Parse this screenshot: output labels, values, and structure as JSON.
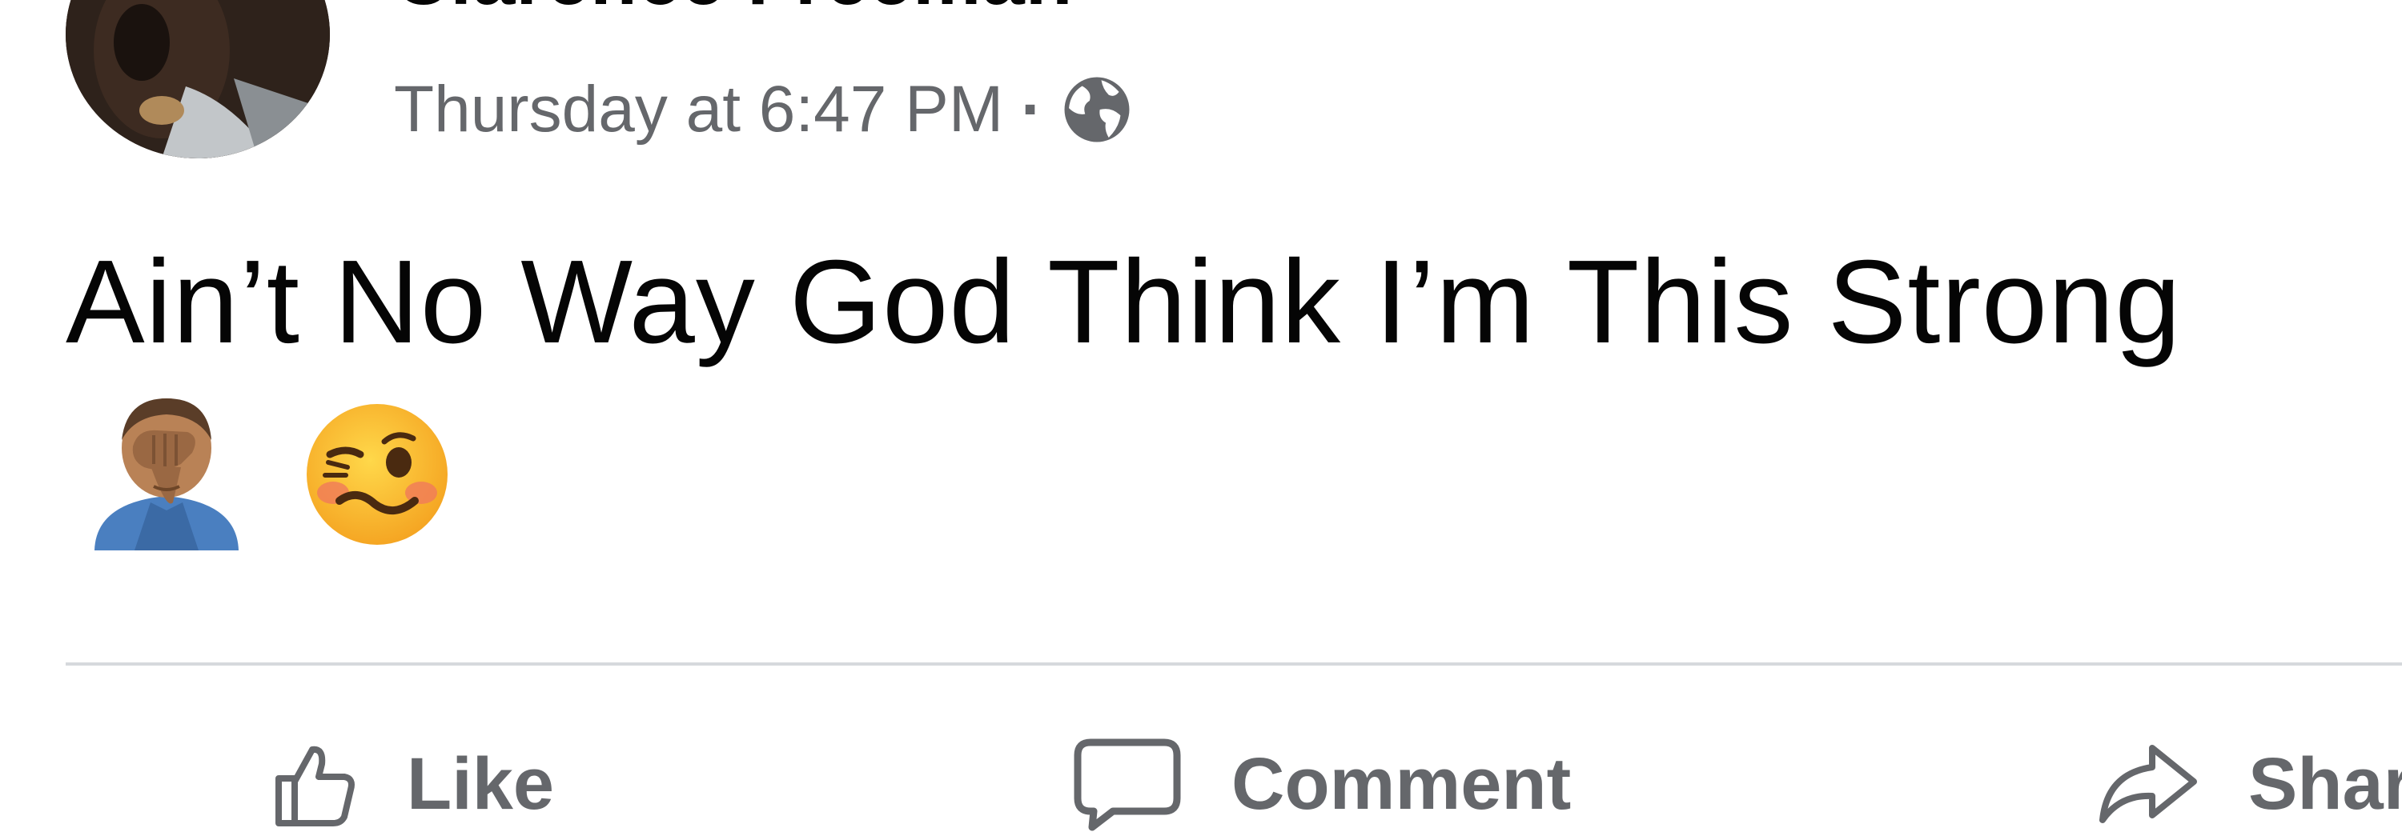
{
  "post": {
    "author": "Clarence Freeman",
    "timestamp": "Thursday at 6:47 PM",
    "separator": "·",
    "privacy_icon": "globe-icon",
    "text": "Ain’t No Way God Think I’m This Strong",
    "emojis": [
      "man-facepalming-emoji",
      "woozy-face-emoji"
    ]
  },
  "actions": {
    "like_label": "Like",
    "comment_label": "Comment",
    "share_label": "Share"
  },
  "colors": {
    "secondary_text": "#65676b",
    "divider": "#d6d9dd",
    "primary_text": "#050505"
  }
}
